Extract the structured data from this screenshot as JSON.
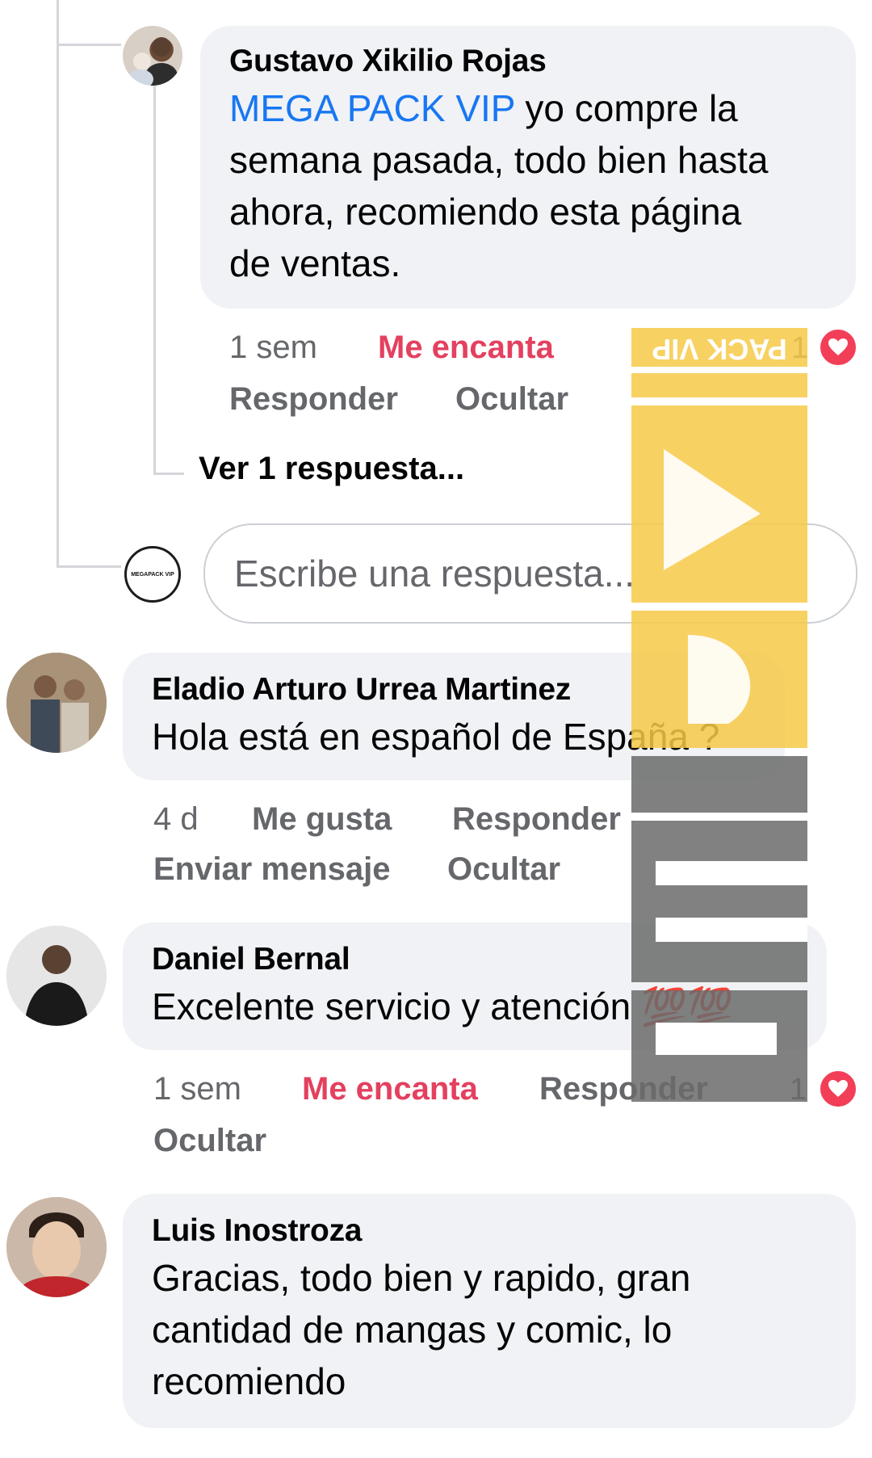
{
  "thread": {
    "reply": {
      "author": "Gustavo Xikilio Rojas",
      "mention": "MEGA PACK VIP",
      "text_lines": [
        " yo compre la",
        "semana pasada, todo bien hasta",
        "ahora, recomiendo esta página",
        "de ventas."
      ],
      "time": "1 sem",
      "reaction_label": "Me encanta",
      "reply_label": "Responder",
      "hide_label": "Ocultar",
      "reaction_count": "1"
    },
    "see_replies": "Ver 1 respuesta...",
    "reply_placeholder": "Escribe una respuesta...",
    "page_avatar_text": "MEGAPACK VIP"
  },
  "comments": [
    {
      "author": "Eladio Arturo Urrea Martinez",
      "text": "Hola está en español de España ?",
      "time": "4 d",
      "like_label": "Me gusta",
      "reply_label": "Responder",
      "message_label": "Enviar mensaje",
      "hide_label": "Ocultar"
    },
    {
      "author": "Daniel Bernal",
      "text": "Excelente servicio y atención ",
      "emoji": "💯💯",
      "time": "1 sem",
      "reaction_label": "Me encanta",
      "reply_label": "Responder",
      "hide_label": "Ocultar",
      "reaction_count": "1"
    },
    {
      "author": "Luis Inostroza",
      "text_lines": [
        "Gracias, todo bien y rapido, gran",
        "cantidad de mangas y comic, lo",
        "recomiendo"
      ]
    }
  ],
  "watermark": {
    "top_text": "PACK VIP",
    "main_text": "MEGA",
    "colors": {
      "yellow": "#f7c948",
      "gray": "#6b6b6b"
    }
  },
  "colors": {
    "mention": "#1877f2",
    "love": "#e4405f",
    "bubble": "#f0f2f5",
    "meta": "#65676b"
  }
}
